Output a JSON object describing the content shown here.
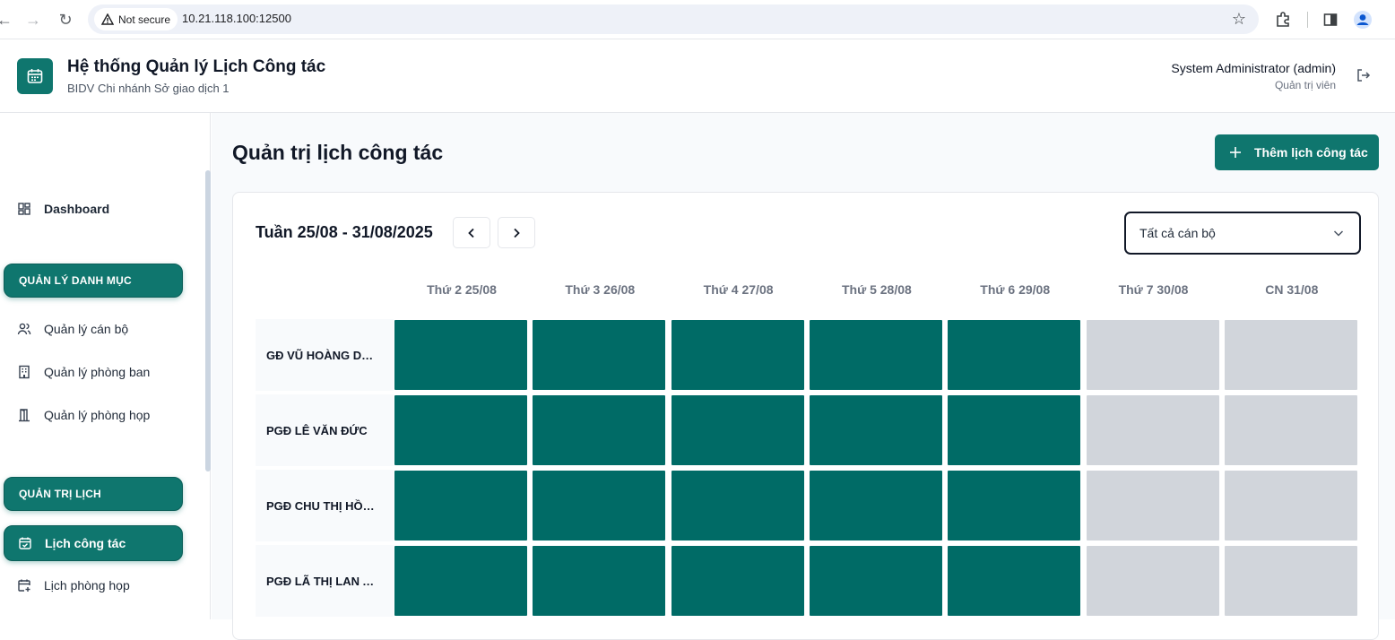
{
  "browser": {
    "security_label": "Not secure",
    "url": "10.21.118.100:12500"
  },
  "header": {
    "title": "Hệ thống Quản lý Lịch Công tác",
    "subtitle": "BIDV Chi nhánh Sở giao dịch 1",
    "user_name": "System Administrator (admin)",
    "user_role": "Quản trị viên"
  },
  "sidebar": {
    "dashboard": "Dashboard",
    "section_catalog": "QUẢN LÝ DANH MỤC",
    "staff": "Quản lý cán bộ",
    "departments": "Quản lý phòng ban",
    "meeting_rooms": "Quản lý phòng họp",
    "section_schedule": "QUẢN TRỊ LỊCH",
    "work_schedule": "Lịch công tác",
    "room_schedule": "Lịch phòng họp"
  },
  "main": {
    "page_title": "Quản trị lịch công tác",
    "add_button": "Thêm lịch công tác",
    "week_label": "Tuần 25/08 - 31/08/2025",
    "staff_filter": "Tất cả cán bộ"
  },
  "schedule": {
    "days": [
      "Thứ 2 25/08",
      "Thứ 3 26/08",
      "Thứ 4 27/08",
      "Thứ 5 28/08",
      "Thứ 6 29/08",
      "Thứ 7 30/08",
      "CN 31/08"
    ],
    "rows": [
      {
        "name": "GĐ VŨ HOÀNG DƯƠNG",
        "busy": [
          true,
          true,
          true,
          true,
          true,
          false,
          false
        ]
      },
      {
        "name": "PGĐ LÊ VĂN ĐỨC",
        "busy": [
          true,
          true,
          true,
          true,
          true,
          false,
          false
        ]
      },
      {
        "name": "PGĐ CHU THỊ HỒNG",
        "busy": [
          true,
          true,
          true,
          true,
          true,
          false,
          false
        ]
      },
      {
        "name": "PGĐ LÃ THỊ LAN ANH",
        "busy": [
          true,
          true,
          true,
          true,
          true,
          false,
          false
        ]
      }
    ]
  },
  "colors": {
    "primary": "#0f766e",
    "busy_cell": "#006b66",
    "free_cell": "#d1d5db"
  }
}
